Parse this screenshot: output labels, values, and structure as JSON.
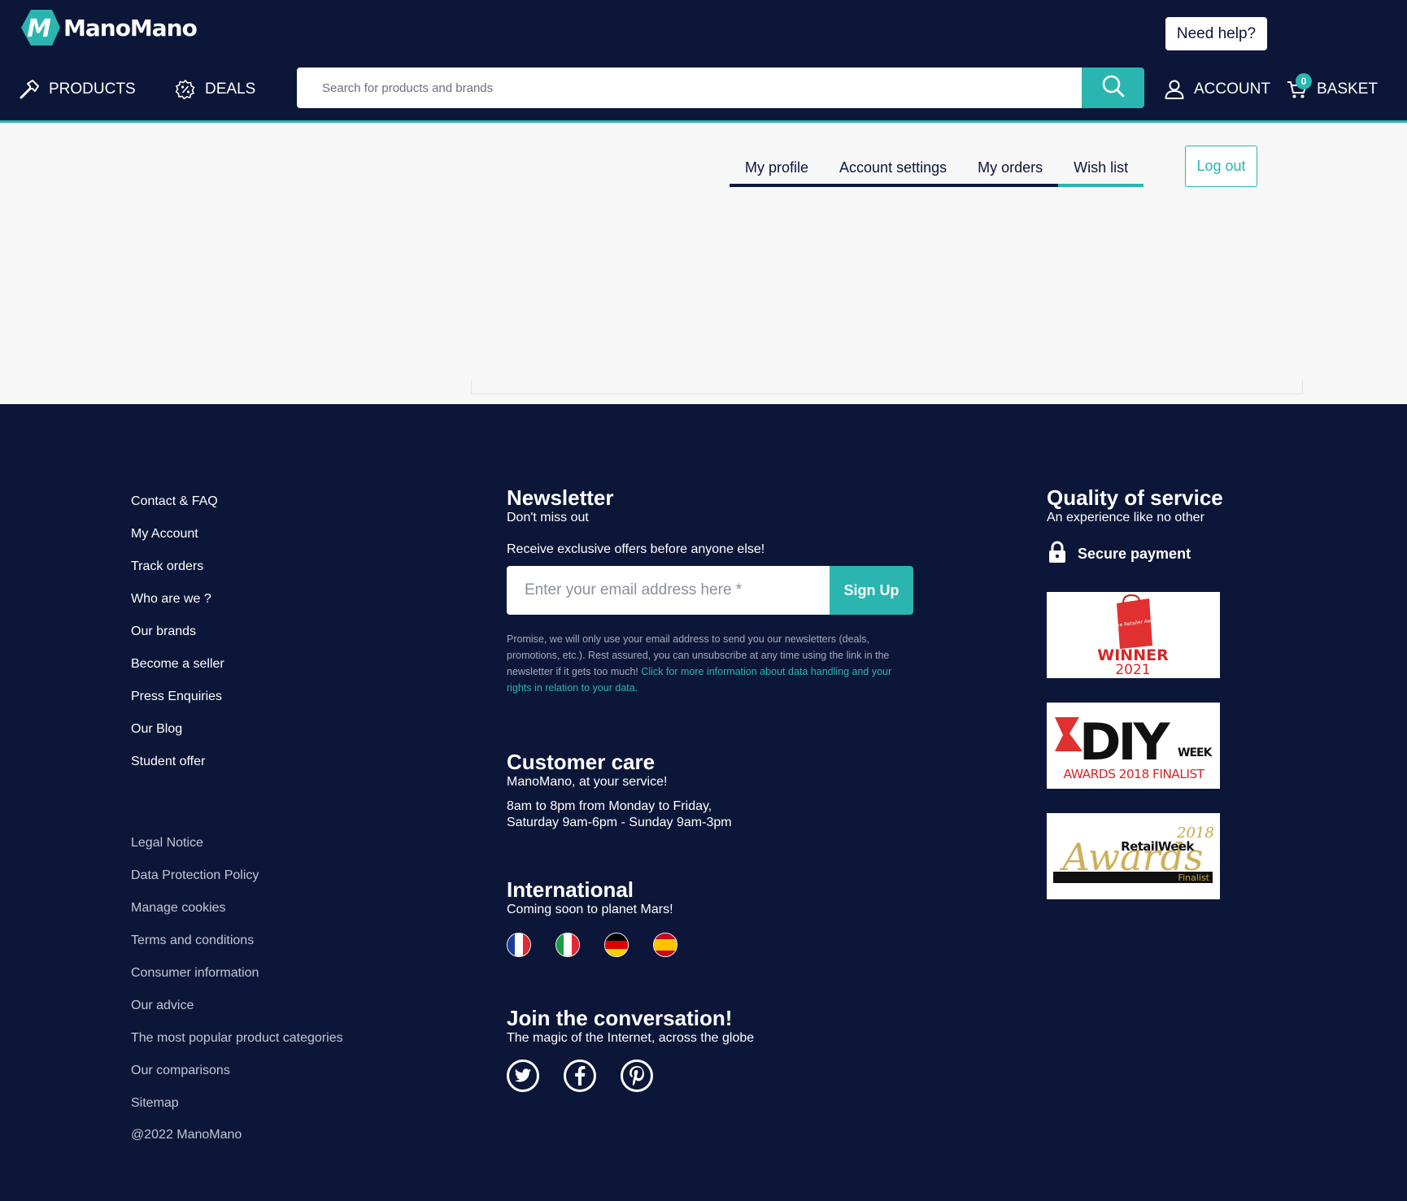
{
  "header": {
    "logo_text": "ManoMano",
    "help_label": "Need help?",
    "nav": {
      "products_label": "PRODUCTS",
      "deals_label": "DEALS",
      "account_label": "ACCOUNT",
      "basket_label": "BASKET",
      "basket_count": "0"
    },
    "search": {
      "placeholder": "Search for products and brands"
    }
  },
  "account": {
    "tabs": [
      {
        "label": "My profile",
        "active": false
      },
      {
        "label": "Account settings",
        "active": false
      },
      {
        "label": "My orders",
        "active": false
      },
      {
        "label": "Wish list",
        "active": true
      }
    ],
    "logout_label": "Log out"
  },
  "footer": {
    "links": [
      "Contact & FAQ",
      "My Account",
      "Track orders",
      "Who are we ?",
      "Our brands",
      "Become a seller",
      "Press Enquiries",
      "Our Blog",
      "Student offer"
    ],
    "legal_links": [
      "Legal Notice",
      "Data Protection Policy",
      "Manage cookies",
      "Terms and conditions",
      "Consumer information",
      "Our advice",
      "The most popular product categories",
      "Our comparisons",
      "Sitemap"
    ],
    "copyright": "@2022 ManoMano",
    "newsletter": {
      "title": "Newsletter",
      "subtitle": "Don't miss out",
      "offer": "Receive exclusive offers before anyone else!",
      "email_placeholder": "Enter your email address here *",
      "signup_label": "Sign Up",
      "note": "Promise, we will only use your email address to send you our newsletters (deals, promotions, etc.). Rest assured, you can unsubscribe at any time using the link in the newsletter if it gets too much! ",
      "note_link": "Click for more information about data handling and your rights in relation to your data."
    },
    "customer_care": {
      "title": "Customer care",
      "subtitle": "ManoMano, at your service!",
      "hours_line1": "8am to 8pm from Monday to Friday,",
      "hours_line2": "Saturday 9am-6pm - Sunday 9am-3pm"
    },
    "international": {
      "title": "International",
      "subtitle": "Coming soon to planet Mars!",
      "flags": [
        "france-flag-icon",
        "italy-flag-icon",
        "germany-flag-icon",
        "spain-flag-icon"
      ]
    },
    "social": {
      "title": "Join the conversation!",
      "subtitle": "The magic of the Internet, across the globe",
      "icons": [
        "twitter-icon",
        "facebook-icon",
        "pinterest-icon"
      ]
    },
    "quality": {
      "title": "Quality of service",
      "subtitle": "An experience like no other",
      "secure_label": "Secure payment",
      "awards": {
        "award1_bag_text": "Online Retailer Awards",
        "award1_line1": "WINNER",
        "award1_line2": "2021",
        "award2_main": "DIY",
        "award2_week": "WEEK",
        "award2_sub": "AWARDS 2018 FINALIST",
        "award3_year": "2018",
        "award3_brand": "RetailWeek",
        "award3_script": "Awards",
        "award3_finalist": "Finalist"
      }
    }
  },
  "colors": {
    "navy": "#0c1638",
    "teal": "#2ab5b0",
    "light_bg": "#f7f7f7"
  }
}
